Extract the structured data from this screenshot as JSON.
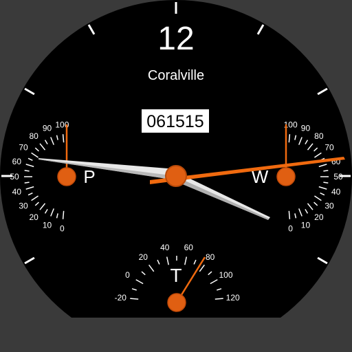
{
  "watch": {
    "hour_label": "12",
    "location": "Coralville",
    "date_code": "061515",
    "colors": {
      "background": "#3a3a3a",
      "dial": "#000000",
      "accent": "#f06a0f",
      "hand_white": "#e8e8e8",
      "text": "#ffffff"
    }
  },
  "gauges": {
    "pressure": {
      "label": "P",
      "scale_labels": [
        "0",
        "10",
        "20",
        "30",
        "40",
        "50",
        "60",
        "70",
        "80",
        "90",
        "100"
      ],
      "value": 100
    },
    "wind": {
      "label": "W",
      "scale_labels": [
        "0",
        "10",
        "20",
        "30",
        "40",
        "50",
        "60",
        "70",
        "80",
        "90",
        "100"
      ],
      "value": 100
    },
    "temperature": {
      "label": "T",
      "scale_labels": [
        "-20",
        "0",
        "20",
        "40",
        "60",
        "80",
        "100",
        "120"
      ],
      "value": 80
    }
  },
  "time": {
    "hour_hand_angle": 290,
    "minute_hand_angle": 122,
    "second_hand_angle": 85
  }
}
